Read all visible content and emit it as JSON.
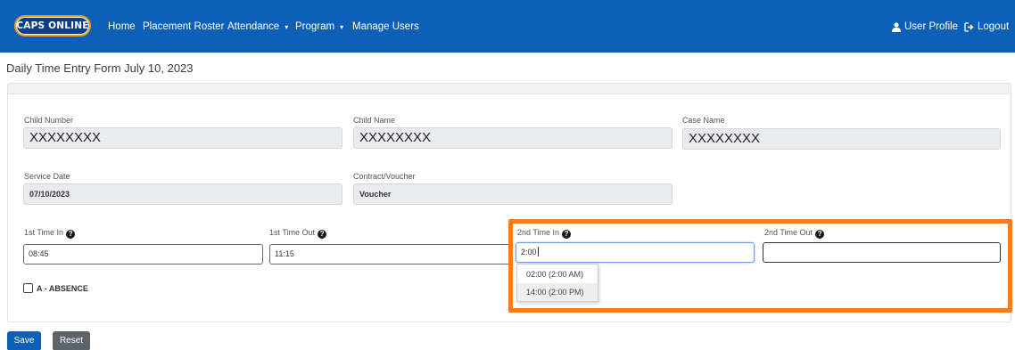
{
  "navbar": {
    "logo_text": "CAPS ONLINE",
    "links": [
      {
        "label": "Home"
      },
      {
        "label": "Placement Roster"
      },
      {
        "label": "Attendance",
        "caret": "▾"
      },
      {
        "label": "Program",
        "caret": "▾"
      },
      {
        "label": "Manage Users"
      }
    ],
    "user_profile": "User Profile",
    "logout": "Logout",
    "user_icon": "user-icon",
    "logout_icon": "sign-out-icon",
    "color": "#0d5fb8"
  },
  "page": {
    "title": "Daily Time Entry Form  July 10, 2023"
  },
  "form": {
    "child_number": {
      "label": "Child Number",
      "value": "XXXXXXXX"
    },
    "child_name": {
      "label": "Child Name",
      "value": "XXXXXXXX"
    },
    "case_name": {
      "label": "Case Name",
      "value": "XXXXXXXX"
    },
    "service_date": {
      "label": "Service Date",
      "value": "07/10/2023"
    },
    "contract_voucher": {
      "label": "Contract/Voucher",
      "value": "Voucher"
    },
    "time_in_1": {
      "label": "1st Time In",
      "value": "08:45"
    },
    "time_out_1": {
      "label": "1st Time Out",
      "value": "11:15"
    },
    "time_in_2": {
      "label": "2nd Time In",
      "value": "2:00"
    },
    "time_out_2": {
      "label": "2nd Time Out",
      "value": ""
    },
    "help_icon": "question-circle-icon",
    "absence": {
      "label": "A - ABSENCE",
      "checked": false
    }
  },
  "time_suggestions": [
    "02:00 (2:00 AM)",
    "14:00 (2:00 PM)"
  ],
  "buttons": {
    "save": "Save",
    "reset": "Reset"
  },
  "colors": {
    "highlight": "#f47d20",
    "primary": "#0d5fb8",
    "secondary": "#5d6368"
  }
}
